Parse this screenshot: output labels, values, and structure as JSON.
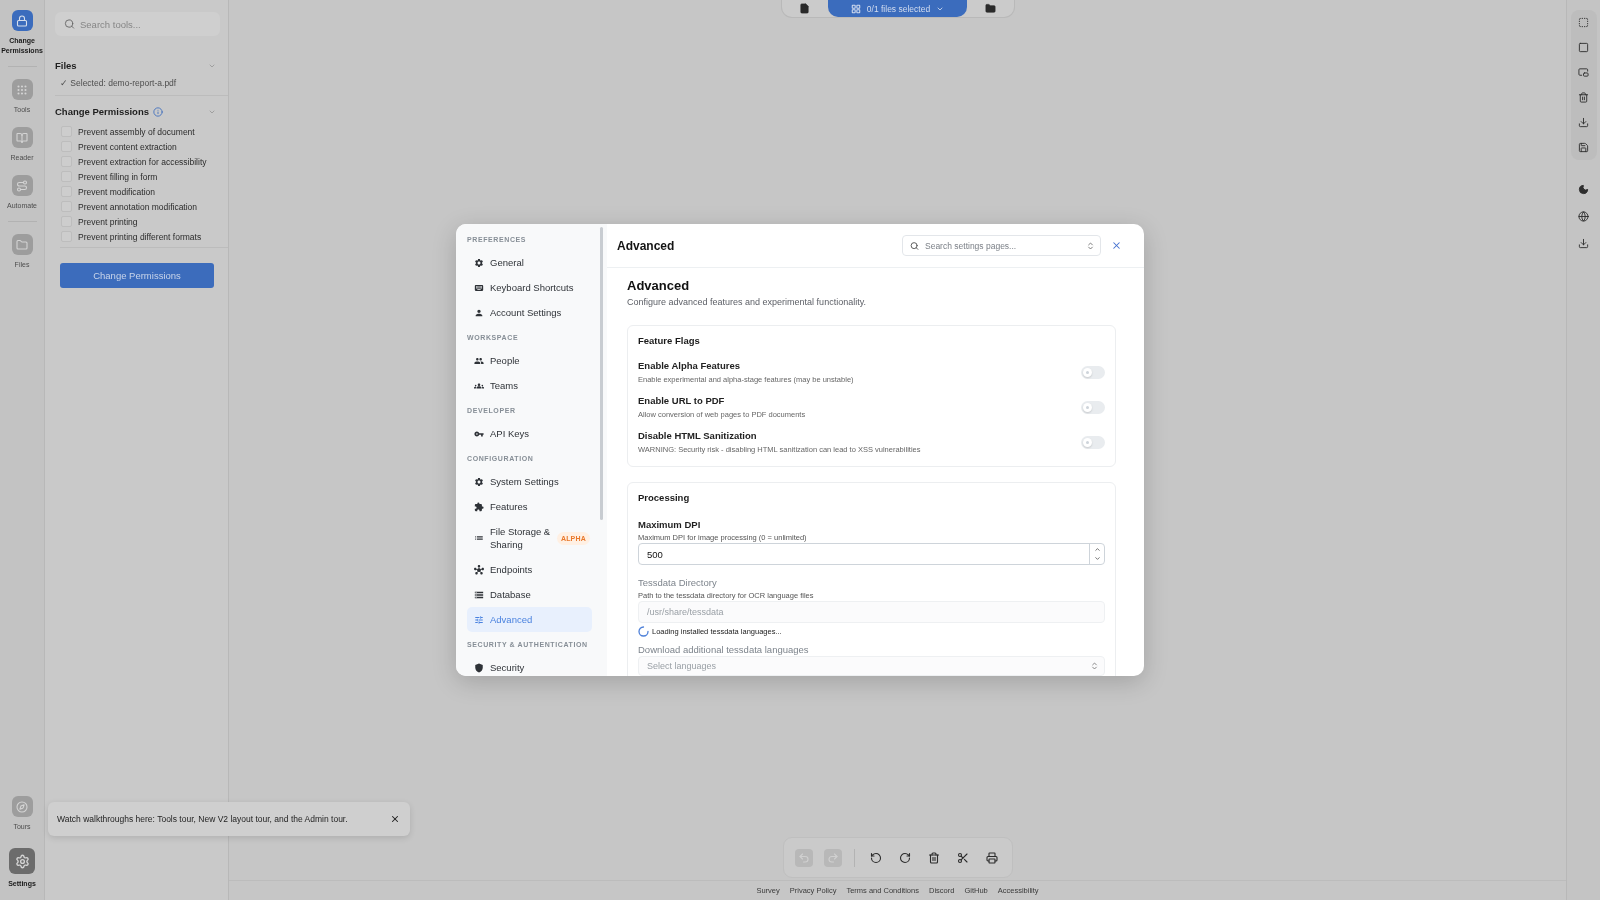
{
  "rail": {
    "groups": [
      {
        "items": [
          {
            "label": "Change Permissions",
            "selected": true
          }
        ]
      },
      {
        "items": [
          {
            "label": "Tools",
            "selected": false
          },
          {
            "label": "Reader",
            "selected": false
          },
          {
            "label": "Automate",
            "selected": false
          }
        ]
      },
      {
        "items": [
          {
            "label": "Files",
            "selected": false
          }
        ]
      }
    ],
    "bottom_items": [
      {
        "label": "Tours",
        "selected": false
      },
      {
        "label": "Settings",
        "selected": true
      }
    ]
  },
  "tool_panel": {
    "search": {
      "placeholder": "Search tools..."
    },
    "files": {
      "title": "Files",
      "expanded": true,
      "selection": "✓ Selected: demo-report-a.pdf"
    },
    "permissions": {
      "title": "Change Permissions",
      "expanded": true,
      "options": [
        {
          "label": "Prevent assembly of document",
          "checked": false
        },
        {
          "label": "Prevent content extraction",
          "checked": false
        },
        {
          "label": "Prevent extraction for accessibility",
          "checked": false
        },
        {
          "label": "Prevent filling in form",
          "checked": false
        },
        {
          "label": "Prevent modification",
          "checked": false
        },
        {
          "label": "Prevent annotation modification",
          "checked": false
        },
        {
          "label": "Prevent printing",
          "checked": false
        },
        {
          "label": "Prevent printing different formats",
          "checked": false
        }
      ]
    },
    "submit_button": "Change Permissions"
  },
  "view_modes": [
    {
      "selected": false
    },
    {
      "label": "0/1 files selected",
      "selected": true
    },
    {
      "selected": false
    }
  ],
  "settings_modal": {
    "nav": [
      {
        "heading": "PREFERENCES",
        "items": [
          {
            "label": "General",
            "selected": false
          },
          {
            "label": "Keyboard Shortcuts",
            "selected": false
          },
          {
            "label": "Account Settings",
            "selected": false
          }
        ]
      },
      {
        "heading": "WORKSPACE",
        "items": [
          {
            "label": "People",
            "selected": false
          },
          {
            "label": "Teams",
            "selected": false
          }
        ]
      },
      {
        "heading": "DEVELOPER",
        "items": [
          {
            "label": "API Keys",
            "selected": false
          }
        ]
      },
      {
        "heading": "CONFIGURATION",
        "items": [
          {
            "label": "System Settings",
            "selected": false
          },
          {
            "label": "Features",
            "selected": false
          },
          {
            "label": "File Storage & Sharing",
            "badge": "ALPHA",
            "selected": false
          },
          {
            "label": "Endpoints",
            "selected": false
          },
          {
            "label": "Database",
            "selected": false
          },
          {
            "label": "Advanced",
            "selected": true
          }
        ]
      },
      {
        "heading": "SECURITY & AUTHENTICATION",
        "items": [
          {
            "label": "Security",
            "selected": false
          }
        ]
      }
    ],
    "header": {
      "title": "Advanced",
      "search_placeholder": "Search settings pages..."
    },
    "page": {
      "title": "Advanced",
      "subtitle": "Configure advanced features and experimental functionality.",
      "feature_flags": {
        "title": "Feature Flags",
        "toggles": [
          {
            "label": "Enable Alpha Features",
            "description": "Enable experimental and alpha-stage features (may be unstable)",
            "on": false
          },
          {
            "label": "Enable URL to PDF",
            "description": "Allow conversion of web pages to PDF documents",
            "on": false
          },
          {
            "label": "Disable HTML Sanitization",
            "description": "WARNING: Security risk - disabling HTML sanitization can lead to XSS vulnerabilities",
            "on": false
          }
        ]
      },
      "processing": {
        "title": "Processing",
        "fields": [
          {
            "kind": "number",
            "label": "Maximum DPI",
            "description": "Maximum DPI for image processing (0 = unlimited)",
            "value": "500",
            "disabled": false
          },
          {
            "kind": "text",
            "label": "Tessdata Directory",
            "description": "Path to the tessdata directory for OCR language files",
            "placeholder": "/usr/share/tessdata",
            "disabled": true
          },
          {
            "kind": "status",
            "text": "Loading installed tessdata languages..."
          },
          {
            "kind": "select",
            "label": "Download additional tessdata languages",
            "placeholder": "Select languages",
            "disabled": true
          }
        ]
      }
    }
  },
  "page_toolbar": [
    {
      "disabled": true
    },
    {
      "disabled": true
    },
    {
      "disabled": false
    },
    {
      "disabled": false
    },
    {
      "disabled": false
    },
    {
      "disabled": false
    },
    {
      "disabled": false
    }
  ],
  "footer_links": [
    "Survey",
    "Privacy Policy",
    "Terms and Conditions",
    "Discord",
    "GitHub",
    "Accessibility"
  ],
  "toast": {
    "message": "Watch walkthroughs here: Tools tour, New V2 layout tour, and the Admin tour."
  }
}
